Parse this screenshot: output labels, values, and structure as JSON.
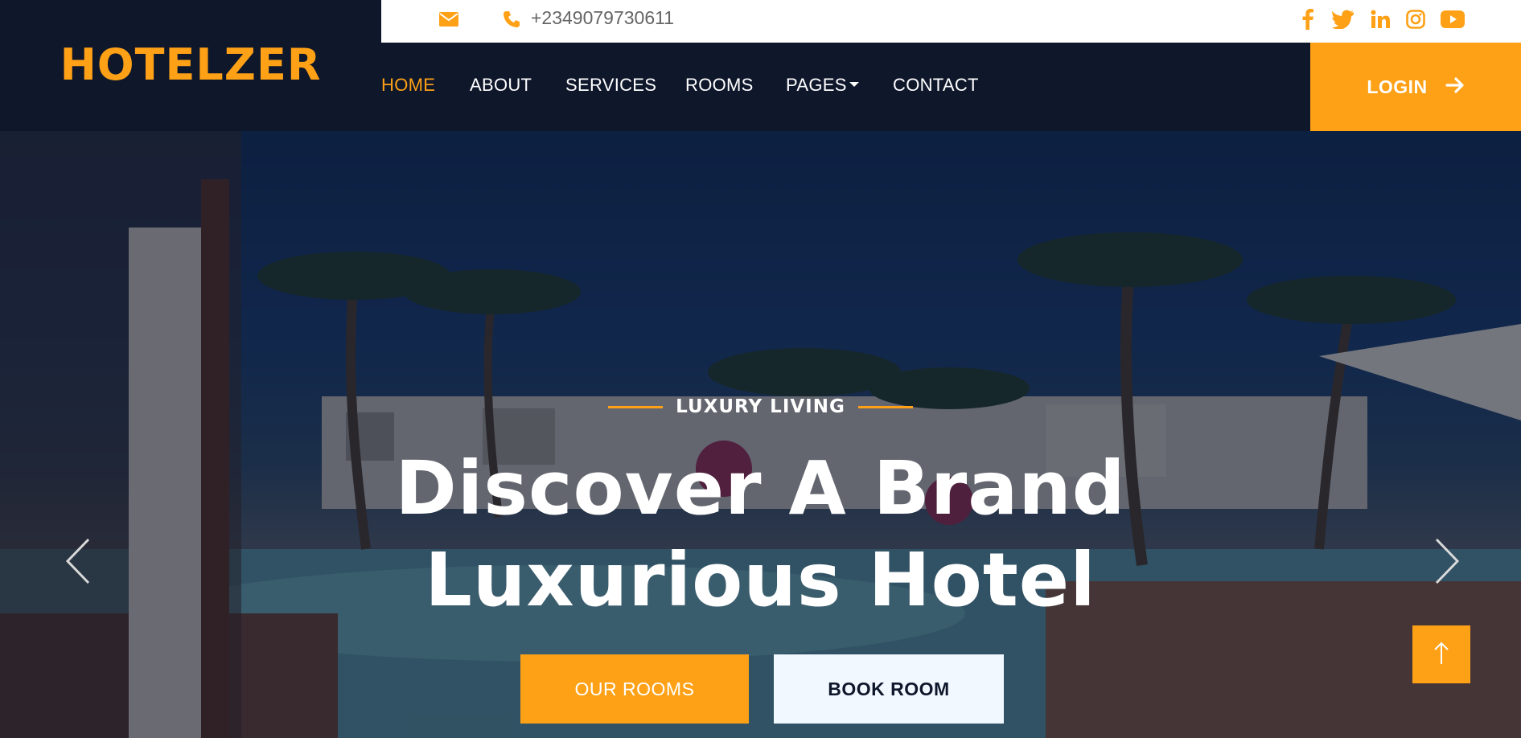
{
  "brand": {
    "logo": "HOTELZER"
  },
  "topbar": {
    "email_icon": "envelope-icon",
    "phone_icon": "phone-icon",
    "phone": "+2349079730611",
    "socials": [
      "facebook-icon",
      "twitter-icon",
      "linkedin-icon",
      "instagram-icon",
      "youtube-icon"
    ]
  },
  "nav": {
    "items": [
      {
        "label": "HOME",
        "active": true
      },
      {
        "label": "ABOUT"
      },
      {
        "label": "SERVICES"
      },
      {
        "label": "ROOMS"
      },
      {
        "label": "PAGES",
        "dropdown": true
      },
      {
        "label": "CONTACT"
      }
    ],
    "login": "LOGIN",
    "login_icon": "arrow-right-icon"
  },
  "hero": {
    "eyebrow": "LUXURY LIVING",
    "title_line1": "Discover A Brand",
    "title_line2": "Luxurious Hotel",
    "primary_button": "OUR ROOMS",
    "secondary_button": "BOOK ROOM",
    "prev_icon": "chevron-left-icon",
    "next_icon": "chevron-right-icon",
    "back_to_top_icon": "arrow-up-icon"
  },
  "colors": {
    "accent": "#fea116",
    "dark": "#0f172b",
    "light": "#f1f8ff"
  }
}
